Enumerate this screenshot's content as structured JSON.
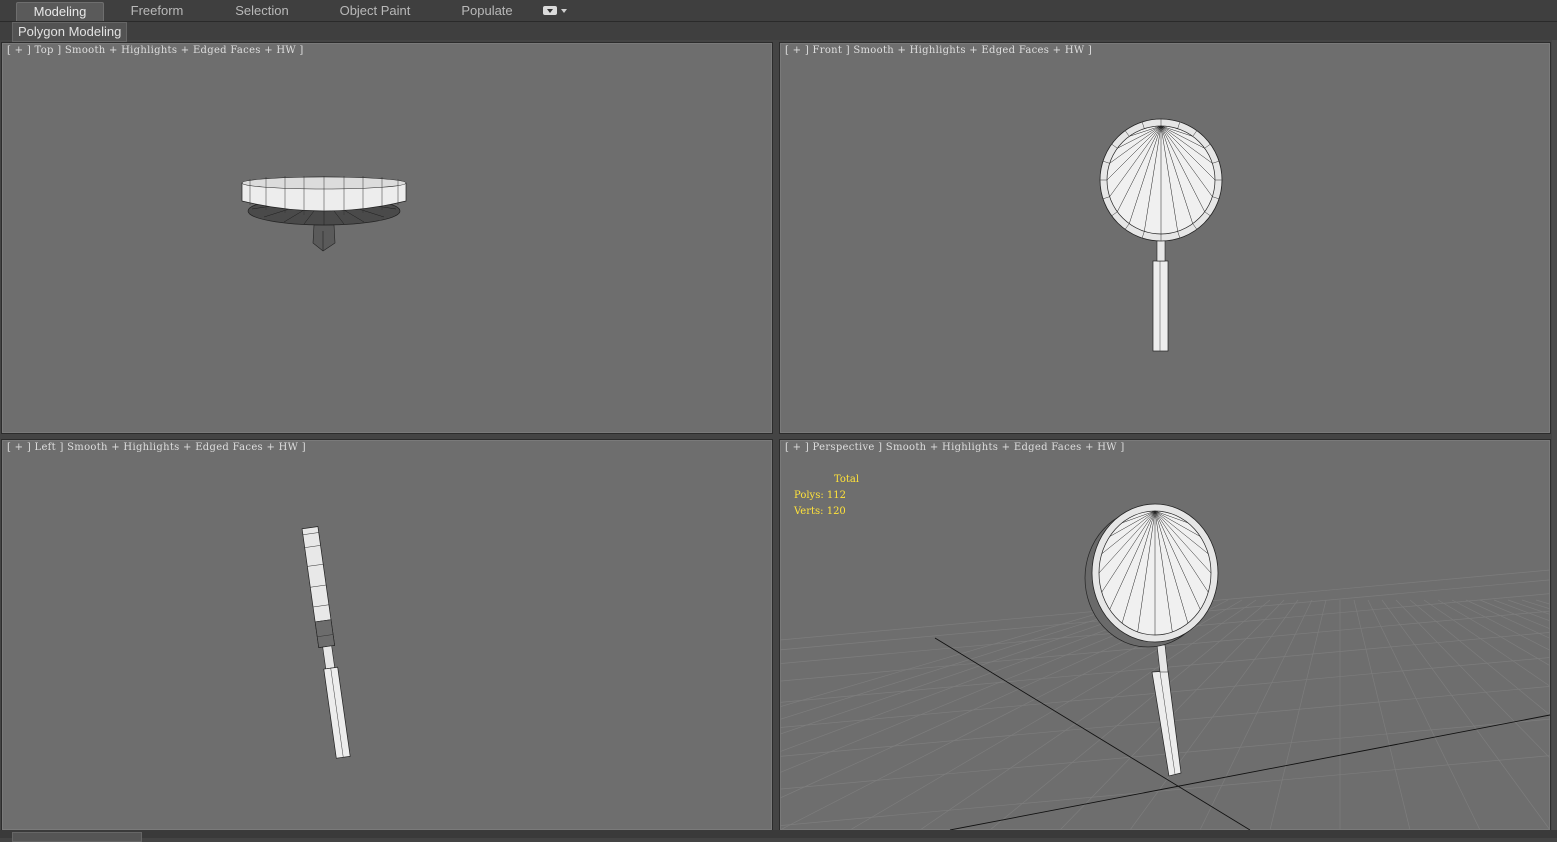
{
  "ribbon": {
    "tabs": [
      {
        "label": "Modeling",
        "active": true
      },
      {
        "label": "Freeform",
        "active": false
      },
      {
        "label": "Selection",
        "active": false
      },
      {
        "label": "Object Paint",
        "active": false
      },
      {
        "label": "Populate",
        "active": false
      }
    ],
    "dropdown_icon": "panel-dropdown-icon",
    "panel_label": "Polygon Modeling"
  },
  "viewports": {
    "top": {
      "label": "[ + ] Top ] Smooth + Highlights + Edged Faces + HW ]"
    },
    "front": {
      "label": "[ + ] Front ] Smooth + Highlights + Edged Faces + HW ]"
    },
    "left": {
      "label": "[ + ] Left ] Smooth + Highlights + Edged Faces + HW ]"
    },
    "perspective": {
      "label": "[ + ] Perspective ] Smooth + Highlights + Edged Faces + HW ]"
    }
  },
  "stats": {
    "title": "Total",
    "polys": "Polys: 112",
    "verts": "Verts: 120"
  },
  "colors": {
    "viewport_bg": "#6e6e6e",
    "ui_bg": "#444444",
    "stats_text": "#ffe23a",
    "model_fill": "#e8e8e8"
  }
}
